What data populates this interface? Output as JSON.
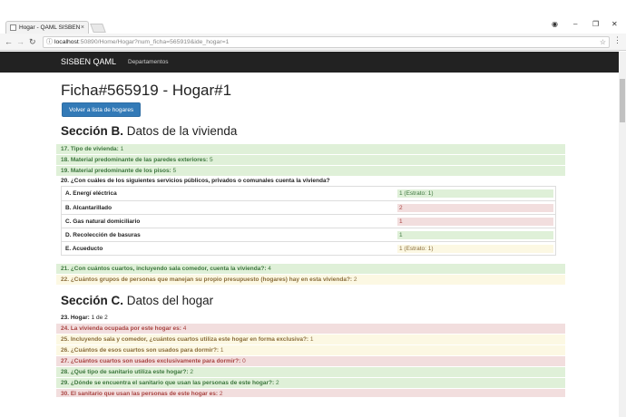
{
  "browser": {
    "tab_title": "Hogar - QAML SISBEN",
    "url_host": "localhost",
    "url_rest": ":50890/Home/Hogar?num_ficha=565919&ide_hogar=1"
  },
  "navbar": {
    "brand": "SISBEN QAML",
    "link": "Departamentos"
  },
  "page": {
    "title": "Ficha#565919 - Hogar#1",
    "back_button": "Volver a lista de hogares"
  },
  "sectionB": {
    "label": "Sección B.",
    "title": "Datos de la vivienda",
    "rows_top": [
      {
        "label": "17. Tipo de vivienda:",
        "value": "1"
      },
      {
        "label": "18. Material predominante de las paredes exteriores:",
        "value": "5"
      },
      {
        "label": "19. Material predominante de los pisos:",
        "value": "5"
      }
    ],
    "q20": "20. ¿Con cuáles de los siguientes servicios públicos, privados o comunales cuenta la vivienda?",
    "services": [
      {
        "label": "A. Energí eléctrica",
        "value": "1 (Estrato: 1)"
      },
      {
        "label": "B. Alcantarillado",
        "value": "2"
      },
      {
        "label": "C. Gas natural domiciliario",
        "value": "1"
      },
      {
        "label": "D. Recolección de basuras",
        "value": "1"
      },
      {
        "label": "E. Acueducto",
        "value": "1 (Estrato: 1)"
      }
    ],
    "rows_bottom": [
      {
        "label": "21. ¿Con cuántos cuartos, incluyendo sala comedor, cuenta la vivienda?:",
        "value": "4"
      },
      {
        "label": "22. ¿Cuántos grupos de personas que manejan su propio presupuesto (hogares) hay en esta vivienda?:",
        "value": "2"
      }
    ]
  },
  "sectionC": {
    "label": "Sección C.",
    "title": "Datos del hogar",
    "q23": {
      "label": "23. Hogar:",
      "value": "1 de 2"
    },
    "rows": [
      {
        "label": "24. La vivienda ocupada por este hogar es:",
        "value": "4"
      },
      {
        "label": "25. Incluyendo sala y comedor, ¿cuántos cuartos utiliza este hogar en forma exclusiva?:",
        "value": "1"
      },
      {
        "label": "26. ¿Cuántos de esos cuartos son usados para dormir?:",
        "value": "1"
      },
      {
        "label": "27. ¿Cuántos cuartos son usados exclusivamente para dormir?:",
        "value": "0"
      },
      {
        "label": "28. ¿Qué tipo de sanitario utiliza este hogar?:",
        "value": "2"
      },
      {
        "label": "29. ¿Dónde se encuentra el sanitario que usan las personas de este hogar?:",
        "value": "2"
      },
      {
        "label": "30. El sanitario que usan las personas de este hogar es:",
        "value": "2"
      }
    ]
  }
}
